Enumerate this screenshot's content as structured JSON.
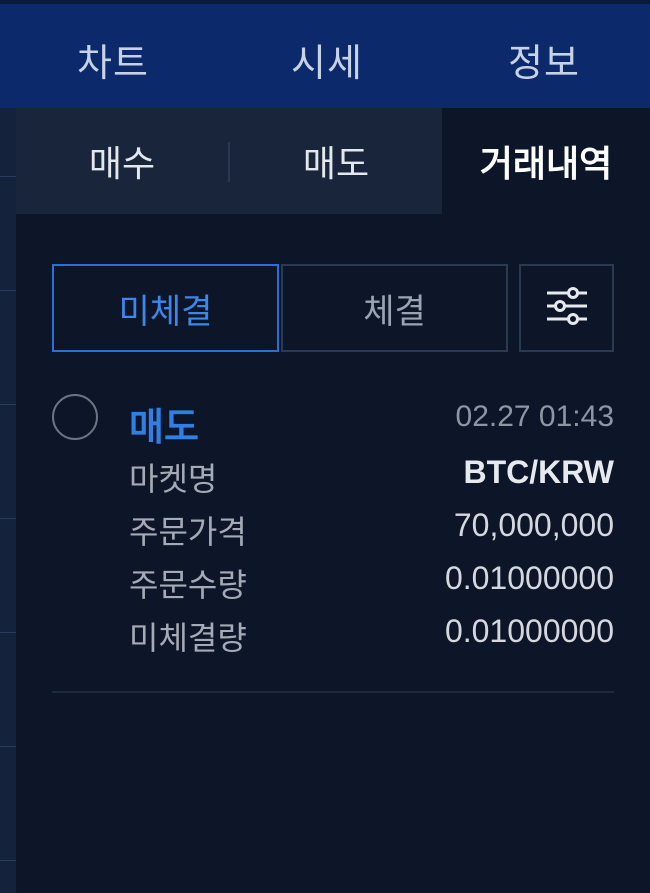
{
  "top_tabs": [
    "차트",
    "시세",
    "정보"
  ],
  "sub_tabs": [
    "매수",
    "매도",
    "거래내역"
  ],
  "filters": {
    "unfilled": "미체결",
    "filled": "체결",
    "settings_icon": "sliders-icon"
  },
  "order": {
    "side": "매도",
    "timestamp": "02.27 01:43",
    "rows": [
      {
        "label": "마켓명",
        "value": "BTC/KRW"
      },
      {
        "label": "주문가격",
        "value": "70,000,000"
      },
      {
        "label": "주문수량",
        "value": "0.01000000"
      },
      {
        "label": "미체결량",
        "value": "0.01000000"
      }
    ]
  },
  "colors": {
    "accent": "#2f7fe6",
    "topbar": "#0c2a6b",
    "background": "#0c1628"
  }
}
